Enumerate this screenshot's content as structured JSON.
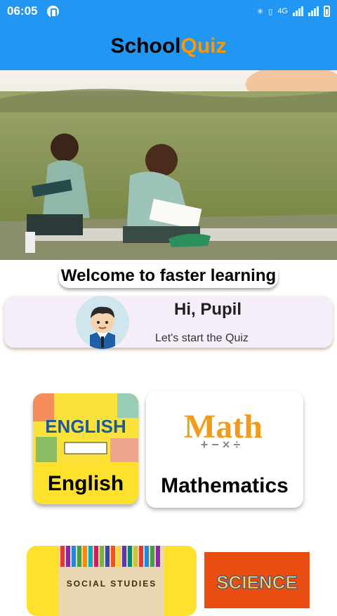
{
  "status_bar": {
    "time": "06:05",
    "network": "4G"
  },
  "app_bar": {
    "title_part1": "School",
    "title_part2": "Quiz"
  },
  "welcome": {
    "text": "Welcome to faster learning"
  },
  "greeting": {
    "title": "Hi, Pupil",
    "subtitle": "Let's start the Quiz"
  },
  "subjects": [
    {
      "label": "English",
      "image_text": "ENGLISH"
    },
    {
      "label": "Mathematics",
      "image_text": "Math"
    },
    {
      "label": "",
      "image_text": "SOCIAL STUDIES"
    },
    {
      "label": "",
      "image_text": "SCIENCE"
    }
  ],
  "colors": {
    "primary": "#2196F3",
    "accent": "#FF9800",
    "card_yellow": "#FDE12D",
    "greeting_bg": "#F5EEF8"
  }
}
